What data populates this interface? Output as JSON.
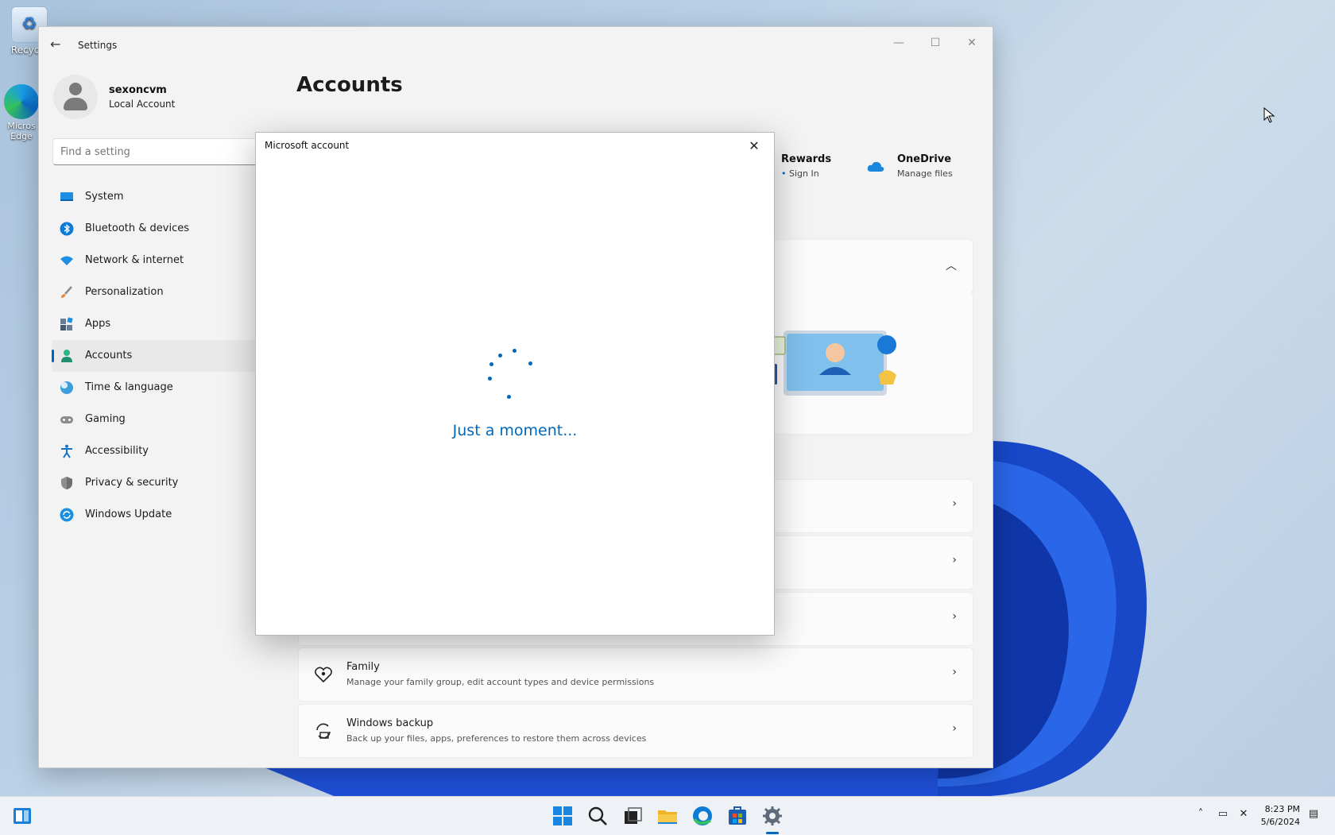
{
  "desktop": {
    "icons": [
      {
        "label": "Recycle"
      },
      {
        "label": "Micros Edge"
      }
    ]
  },
  "settings": {
    "title": "Settings",
    "user": {
      "name": "sexoncvm",
      "type": "Local Account"
    },
    "search_placeholder": "Find a setting",
    "nav": [
      {
        "label": "System"
      },
      {
        "label": "Bluetooth & devices"
      },
      {
        "label": "Network & internet"
      },
      {
        "label": "Personalization"
      },
      {
        "label": "Apps"
      },
      {
        "label": "Accounts"
      },
      {
        "label": "Time & language"
      },
      {
        "label": "Gaming"
      },
      {
        "label": "Accessibility"
      },
      {
        "label": "Privacy & security"
      },
      {
        "label": "Windows Update"
      }
    ],
    "page_title": "Accounts",
    "tiles": {
      "rewards": {
        "title": "Rewards",
        "subtitle": "Sign In"
      },
      "onedrive": {
        "title": "OneDrive",
        "subtitle": "Manage files"
      }
    },
    "rows": [
      {
        "title": "Family",
        "subtitle": "Manage your family group, edit account types and device permissions"
      },
      {
        "title": "Windows backup",
        "subtitle": "Back up your files, apps, preferences to restore them across devices"
      }
    ]
  },
  "dialog": {
    "title": "Microsoft account",
    "message": "Just a moment..."
  },
  "taskbar": {
    "time": "8:23 PM",
    "date": "5/6/2024"
  },
  "colors": {
    "accent": "#0067c0",
    "link": "#0067b8"
  }
}
